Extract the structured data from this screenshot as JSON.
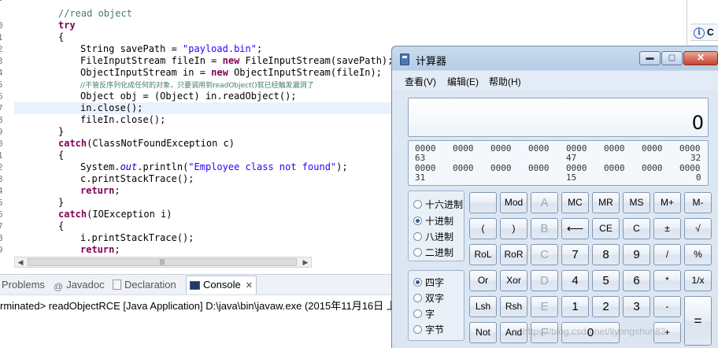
{
  "editor": {
    "line_numbers": [
      "8",
      "0",
      "1",
      "2",
      "3",
      "4",
      "5",
      "6",
      "7",
      "8",
      "9",
      "0",
      "1",
      "2",
      "3",
      "4",
      "5",
      "6",
      "7",
      "8",
      "9"
    ],
    "code": {
      "c1": "//read object",
      "try": "try",
      "brace_open": "{",
      "l3_a": "String savePath = ",
      "l3_s": "\"payload.bin\"",
      "l3_b": ";",
      "l4_a": "FileInputStream fileIn = ",
      "l4_kw": "new",
      "l4_b": " FileInputStream(savePath);",
      "l5_a": "ObjectInputStream in = ",
      "l5_kw": "new",
      "l5_b": " ObjectInputStream(fileIn);",
      "l6_cm": "//不管反序列化成任何的对象，只要调用到readObject()就已经触发漏洞了",
      "l7": "Object obj = (Object) in.readObject();",
      "l8": "in.close();",
      "l9": "fileIn.close();",
      "brace_close": "}",
      "catch1_kw": "catch",
      "catch1": "(ClassNotFoundException c)",
      "l12_a": "System.",
      "l12_it": "out",
      "l12_b": ".println(",
      "l12_s": "\"Employee class not found\"",
      "l12_c": ");",
      "l13": "c.printStackTrace();",
      "return": "return",
      "semi": ";",
      "catch2_kw": "catch",
      "catch2": "(IOException i)",
      "l18": "i.printStackTrace();"
    },
    "scroll_thumb_mark": "|||"
  },
  "right_pane": {
    "label": "C"
  },
  "console_tabs": [
    {
      "label": "Problems"
    },
    {
      "label": "Javadoc"
    },
    {
      "label": "Declaration"
    },
    {
      "label": "Console",
      "close": "✕"
    }
  ],
  "console_header": "rminated> readObjectRCE [Java Application] D:\\java\\bin\\javaw.exe (2015年11月16日 上",
  "calculator": {
    "title": "计算器",
    "window_buttons": {
      "minimize": "▬",
      "maximize": "▢",
      "close": "✕"
    },
    "menu": [
      "查看(V)",
      "编辑(E)",
      "帮助(H)"
    ],
    "display_value": "0",
    "bit_rows": [
      {
        "groups": [
          "0000",
          "0000",
          "0000",
          "0000",
          "0000",
          "0000",
          "0000",
          "0000"
        ],
        "marks": [
          "63",
          "47",
          "32"
        ]
      },
      {
        "groups": [
          "0000",
          "0000",
          "0000",
          "0000",
          "0000",
          "0000",
          "0000",
          "0000"
        ],
        "marks": [
          "31",
          "15",
          "0"
        ]
      }
    ],
    "base_options": [
      {
        "label": "十六进制",
        "selected": false
      },
      {
        "label": "十进制",
        "selected": true
      },
      {
        "label": "八进制",
        "selected": false
      },
      {
        "label": "二进制",
        "selected": false
      }
    ],
    "word_options": [
      {
        "label": "四字",
        "selected": true
      },
      {
        "label": "双字",
        "selected": false
      },
      {
        "label": "字",
        "selected": false
      },
      {
        "label": "字节",
        "selected": false
      }
    ],
    "keys": {
      "r1": [
        "",
        "Mod",
        "A",
        "MC",
        "MR",
        "MS",
        "M+",
        "M-"
      ],
      "r2": [
        "(",
        ")",
        "B",
        "⟵",
        "CE",
        "C",
        "±",
        "√"
      ],
      "r3": [
        "RoL",
        "RoR",
        "C",
        "7",
        "8",
        "9",
        "/",
        "%"
      ],
      "r4": [
        "Or",
        "Xor",
        "D",
        "4",
        "5",
        "6",
        "*",
        "1/x"
      ],
      "r5": [
        "Lsh",
        "Rsh",
        "E",
        "1",
        "2",
        "3",
        "-",
        "="
      ],
      "r6": [
        "Not",
        "And",
        "F",
        "0",
        "+"
      ]
    }
  },
  "watermark": "https://blog.csdn.net/liyongshun82"
}
